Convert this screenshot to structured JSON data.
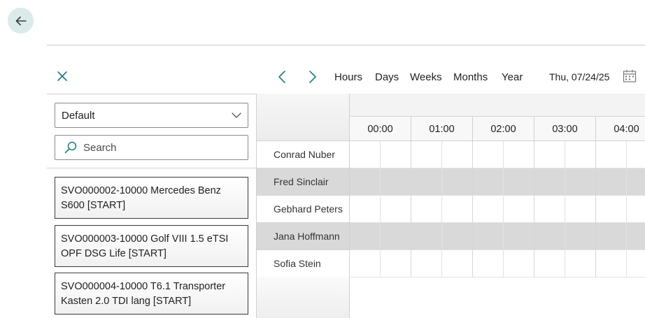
{
  "nav": {
    "back_icon": "arrow-left-icon"
  },
  "toolbar": {
    "close_icon": "close-icon",
    "prev_icon": "chevron-left-icon",
    "next_icon": "chevron-right-icon",
    "views": [
      "Hours",
      "Days",
      "Weeks",
      "Months",
      "Year"
    ],
    "date": "Thu, 07/24/25",
    "calendar_icon": "calendar-icon"
  },
  "filter": {
    "selected": "Default",
    "search_placeholder": "Search"
  },
  "orders": [
    {
      "line1": "SVO000002-10000 Mercedes Benz",
      "line2": "S600 [START]"
    },
    {
      "line1": "SVO000003-10000 Golf VIII 1.5 eTSI",
      "line2": "OPF DSG Life [START]"
    },
    {
      "line1": "SVO000004-10000 T6.1 Transporter",
      "line2": "Kasten 2.0 TDI lang [START]"
    }
  ],
  "resources": [
    "Conrad Nuber",
    "Fred Sinclair",
    "Gebhard Peters",
    "Jana Hoffmann",
    "Sofia Stein"
  ],
  "timeline": {
    "hours": [
      "00:00",
      "01:00",
      "02:00",
      "03:00",
      "04:00"
    ]
  }
}
